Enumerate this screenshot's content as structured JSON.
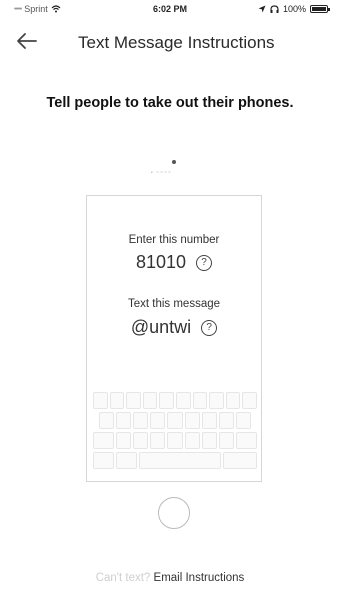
{
  "status_bar": {
    "signal_dots": "•••••",
    "carrier": "Sprint",
    "wifi_icon": "wifi-icon",
    "time": "6:02 PM",
    "location_icon": "location-arrow-icon",
    "headphones_icon": "headphones-icon",
    "battery_percent": "100%",
    "battery_level": 1.0
  },
  "nav": {
    "back_icon": "arrow-left-icon",
    "title": "Text Message Instructions"
  },
  "headline": "Tell people to take out their phones.",
  "phone": {
    "number_label": "Enter this number",
    "number": "81010",
    "message_label": "Text this message",
    "message": "@untwi",
    "help_icon": "question-circle-icon"
  },
  "footer": {
    "muted_text": "Can't text?",
    "link_text": "Email Instructions"
  }
}
